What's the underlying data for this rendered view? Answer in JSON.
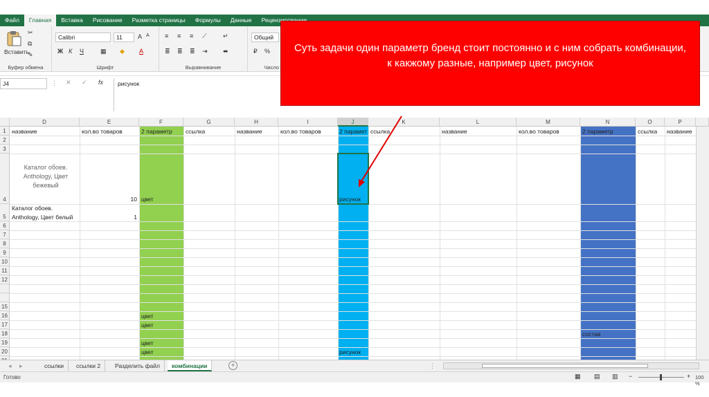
{
  "tabs": [
    "Файл",
    "Главная",
    "Вставка",
    "Рисование",
    "Разметка страницы",
    "Формулы",
    "Данные",
    "Рецензирование"
  ],
  "active_tab": "Главная",
  "ribbon": {
    "paste_label": "Вставить",
    "clipboard_label": "Буфер обмена",
    "font_name": "Calibri",
    "font_size": "11",
    "font_group_label": "Шрифт",
    "align_group_label": "Выравнивание",
    "number_format": "Общий",
    "number_group_label": "Число",
    "bold": "Ж",
    "italic": "К",
    "underline": "Ч"
  },
  "formula_bar": {
    "cell_ref": "J4",
    "fx": "fx",
    "content": "рисунок"
  },
  "columns": [
    "D",
    "E",
    "F",
    "G",
    "H",
    "I",
    "J",
    "K",
    "L",
    "M",
    "N",
    "O",
    "P"
  ],
  "selected_column": "J",
  "rows": [
    "1",
    "2",
    "3",
    "4",
    "5",
    "6",
    "7",
    "8",
    "9",
    "10",
    "11",
    "12",
    "15",
    "16",
    "17",
    "18",
    "19",
    "20",
    "21"
  ],
  "headers_row1": {
    "D": "название",
    "E": "кол.во товаров",
    "F": "2 параметр",
    "G": "ссылка",
    "H": "название",
    "I": "кол.во товаров",
    "J": "2 парамет",
    "K": "ссылка",
    "L": "название",
    "M": "кол.во товаров",
    "N": "2 параметр",
    "O": "ссылка",
    "P": "название"
  },
  "cells": {
    "D4": "Каталог обоев. Anthology, Цвет бежевый",
    "E4": "10",
    "F4": "цвет",
    "J4": "рисунок",
    "D5a": "Каталог обоев.",
    "D5b": "Anthology, Цвет белый",
    "E5": "1",
    "F16": "цвет",
    "F17": "цвет",
    "F19": "цвет",
    "F20": "цвет",
    "J20": "рисунок",
    "N18": "состав"
  },
  "colors": {
    "F": "#92d050",
    "J": "#00b0f0",
    "N": "#4472c4",
    "note": "#ff0000",
    "accent": "#217346"
  },
  "sheet_tabs": [
    "ссылки",
    "ссылки 2",
    "Разделить файл",
    "комбинации"
  ],
  "active_sheet": "комбинации",
  "status_text": "Готово",
  "zoom": "100 %",
  "note_text": "Суть задачи один параметр бренд стоит постоянно и с ним собрать комбинации, к какжому разные,  например цвет, рисунок"
}
